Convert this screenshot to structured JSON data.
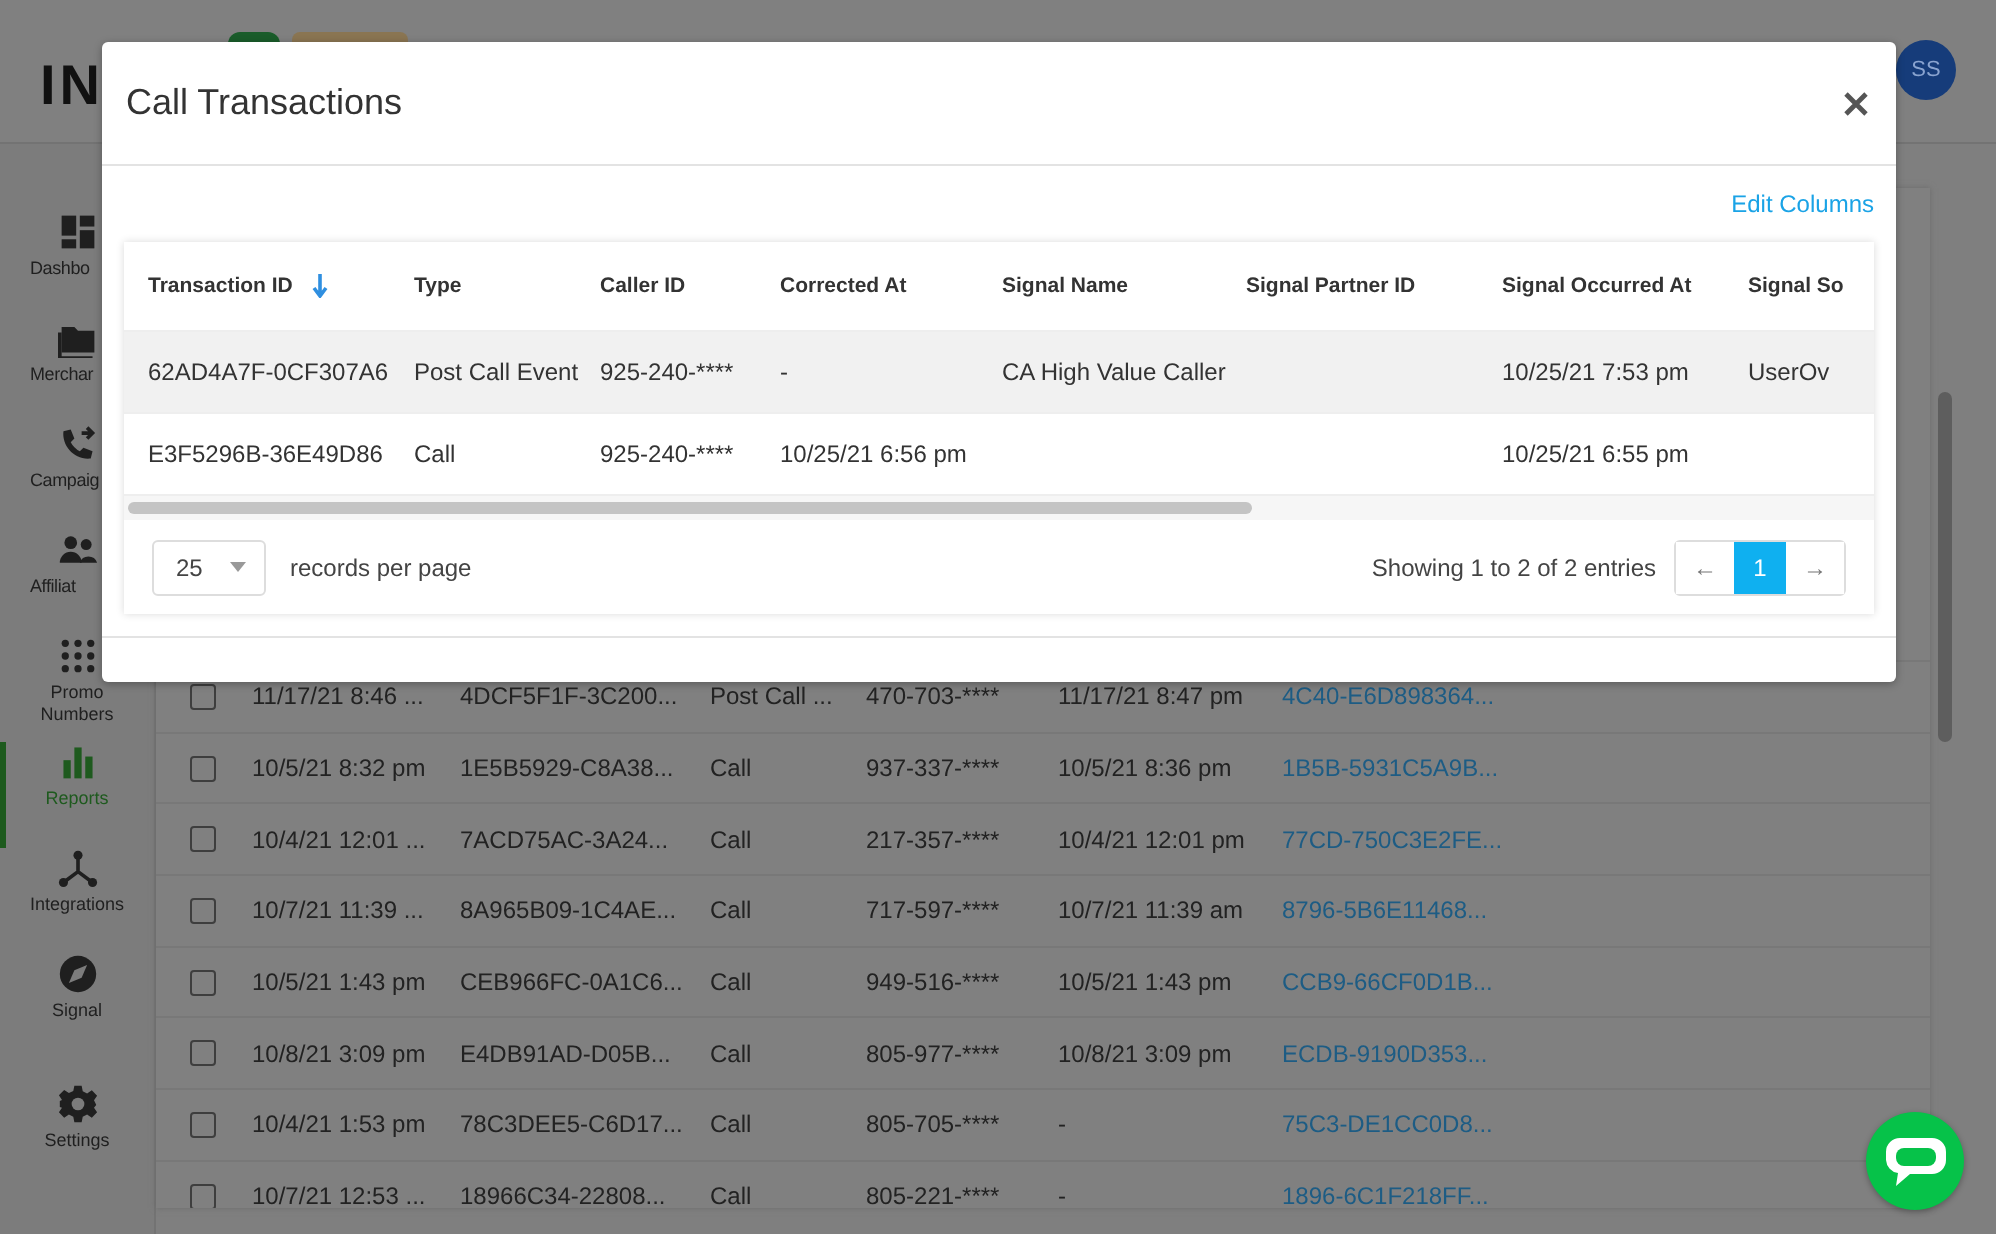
{
  "app": {
    "logo": "IN",
    "avatar": "SS",
    "sidebar": [
      {
        "label": "Dashbo",
        "kind": "dashboard",
        "selected": false
      },
      {
        "label": "Merchar",
        "kind": "folder",
        "selected": false
      },
      {
        "label": "Campaig",
        "kind": "phone",
        "selected": false
      },
      {
        "label": "Affiliat",
        "kind": "people",
        "selected": false
      },
      {
        "label": "Promo Numbers",
        "kind": "dots",
        "selected": false
      },
      {
        "label": "Reports",
        "kind": "bars",
        "selected": true
      },
      {
        "label": "Integrations",
        "kind": "network",
        "selected": false
      },
      {
        "label": "Signal",
        "kind": "compass",
        "selected": false
      }
    ],
    "settings": {
      "label": "Settings",
      "kind": "gear"
    },
    "rows": [
      {
        "checked": false,
        "cells": [
          "11/17/21 8:46 ...",
          "4DCF5F1F-3C200...",
          "Post Call ...",
          "470-703-****",
          "11/17/21 8:47 pm",
          "4C40-E6D898364..."
        ]
      },
      {
        "checked": false,
        "cells": [
          "10/5/21 8:32 pm",
          "1E5B5929-C8A38...",
          "Call",
          "937-337-****",
          "10/5/21 8:36 pm",
          "1B5B-5931C5A9B..."
        ]
      },
      {
        "checked": false,
        "cells": [
          "10/4/21 12:01 ...",
          "7ACD75AC-3A24...",
          "Call",
          "217-357-****",
          "10/4/21 12:01 pm",
          "77CD-750C3E2FE..."
        ]
      },
      {
        "checked": false,
        "cells": [
          "10/7/21 11:39 ...",
          "8A965B09-1C4AE...",
          "Call",
          "717-597-****",
          "10/7/21 11:39 am",
          "8796-5B6E11468..."
        ]
      },
      {
        "checked": false,
        "cells": [
          "10/5/21 1:43 pm",
          "CEB966FC-0A1C6...",
          "Call",
          "949-516-****",
          "10/5/21 1:43 pm",
          "CCB9-66CF0D1B..."
        ]
      },
      {
        "checked": false,
        "cells": [
          "10/8/21 3:09 pm",
          "E4DB91AD-D05B...",
          "Call",
          "805-977-****",
          "10/8/21 3:09 pm",
          "ECDB-9190D353..."
        ]
      },
      {
        "checked": false,
        "cells": [
          "10/4/21 1:53 pm",
          "78C3DEE5-C6D17...",
          "Call",
          "805-705-****",
          "-",
          "75C3-DE1CC0D8..."
        ]
      },
      {
        "checked": false,
        "cells": [
          "10/7/21 12:53 ...",
          "18966C34-22808...",
          "Call",
          "805-221-****",
          "-",
          "1896-6C1F218FF..."
        ]
      }
    ]
  },
  "modal": {
    "title": "Call Transactions",
    "edit_columns": "Edit Columns",
    "columns": [
      {
        "label": "Transaction ID",
        "sorted": true
      },
      {
        "label": "Type",
        "sorted": false
      },
      {
        "label": "Caller ID",
        "sorted": false
      },
      {
        "label": "Corrected At",
        "sorted": false
      },
      {
        "label": "Signal Name",
        "sorted": false
      },
      {
        "label": "Signal Partner ID",
        "sorted": false
      },
      {
        "label": "Signal Occurred At",
        "sorted": false
      },
      {
        "label": "Signal So",
        "sorted": false
      }
    ],
    "rows": [
      {
        "highlighted": true,
        "cells": [
          "62AD4A7F-0CF307A6",
          "Post Call Event",
          "925-240-****",
          "-",
          "CA High Value Caller",
          null,
          "10/25/21 7:53 pm",
          "UserOv"
        ]
      },
      {
        "highlighted": false,
        "cells": [
          "E3F5296B-36E49D86",
          "Call",
          "925-240-****",
          "10/25/21 6:56 pm",
          null,
          null,
          "10/25/21 6:55 pm",
          null
        ]
      }
    ],
    "per_page": "25",
    "per_page_label": "records per page",
    "info": "Showing 1 to 2 of 2 entries",
    "prev": "←",
    "pages": [
      {
        "label": "1",
        "selected": true
      }
    ],
    "next": "→"
  }
}
